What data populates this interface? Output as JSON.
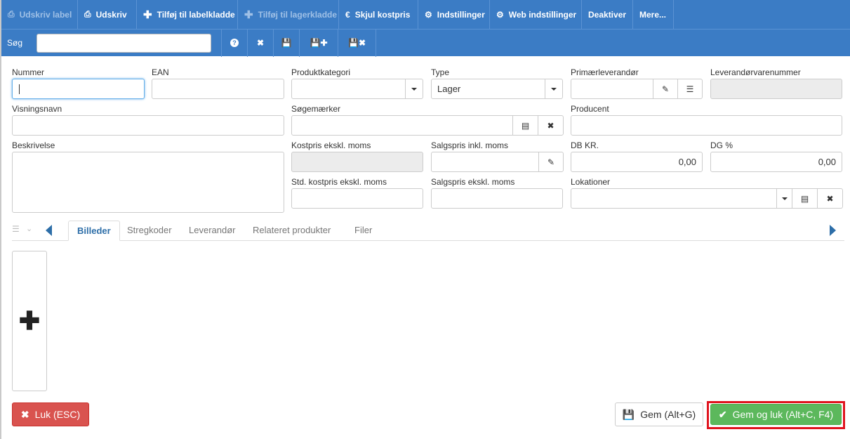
{
  "toolbar": {
    "items": [
      {
        "label": "Udskriv label",
        "icon": "print-icon",
        "disabled": true
      },
      {
        "label": "Udskriv",
        "icon": "print-icon",
        "disabled": false
      },
      {
        "label": "Tilføj til labelkladde",
        "icon": "plus-icon",
        "disabled": false
      },
      {
        "label": "Tilføj til lagerkladde",
        "icon": "plus-icon",
        "disabled": true
      },
      {
        "label": "Skjul kostpris",
        "icon": "euro-icon",
        "disabled": false
      },
      {
        "label": "Indstillinger",
        "icon": "gear-icon",
        "disabled": false
      },
      {
        "label": "Web indstillinger",
        "icon": "gear-icon",
        "disabled": false
      },
      {
        "label": "Deaktiver",
        "icon": "",
        "disabled": false
      },
      {
        "label": "Mere...",
        "icon": "",
        "disabled": false
      }
    ]
  },
  "search": {
    "label": "Søg",
    "value": "",
    "buttons": [
      "help-icon",
      "clear-icon",
      "save-icon",
      "save-new-icon",
      "save-delete-icon"
    ]
  },
  "form": {
    "nummer": {
      "label": "Nummer",
      "value": ""
    },
    "ean": {
      "label": "EAN",
      "value": ""
    },
    "produktkategori": {
      "label": "Produktkategori",
      "value": ""
    },
    "type": {
      "label": "Type",
      "value": "Lager"
    },
    "primaerleverandor": {
      "label": "Primærleverandør",
      "value": ""
    },
    "leverandorvarenummer": {
      "label": "Leverandørvarenummer",
      "value": ""
    },
    "visningsnavn": {
      "label": "Visningsnavn",
      "value": ""
    },
    "sogemaerker": {
      "label": "Søgemærker",
      "value": ""
    },
    "producent": {
      "label": "Producent",
      "value": ""
    },
    "beskrivelse": {
      "label": "Beskrivelse",
      "value": ""
    },
    "kostpris": {
      "label": "Kostpris ekskl. moms",
      "value": ""
    },
    "salgspris_inkl": {
      "label": "Salgspris inkl. moms",
      "value": ""
    },
    "db_kr": {
      "label": "DB KR.",
      "value": "0,00"
    },
    "dg_pct": {
      "label": "DG %",
      "value": "0,00"
    },
    "std_kostpris": {
      "label": "Std. kostpris ekskl. moms",
      "value": ""
    },
    "salgspris_ekskl": {
      "label": "Salgspris ekskl. moms",
      "value": ""
    },
    "lokationer": {
      "label": "Lokationer",
      "value": ""
    }
  },
  "tabs": [
    {
      "label": "Billeder",
      "active": true
    },
    {
      "label": "Stregkoder",
      "active": false
    },
    {
      "label": "Leverandør",
      "active": false
    },
    {
      "label": "Relateret produkter",
      "active": false
    },
    {
      "label": "Filer",
      "active": false
    }
  ],
  "footer": {
    "close_label": "Luk (ESC)",
    "save_label": "Gem (Alt+G)",
    "save_close_label": "Gem og luk (Alt+C, F4)"
  },
  "colors": {
    "toolbar": "#3b7cc5",
    "danger": "#d9534f",
    "success": "#5cb85c",
    "highlight": "#e0141e"
  }
}
